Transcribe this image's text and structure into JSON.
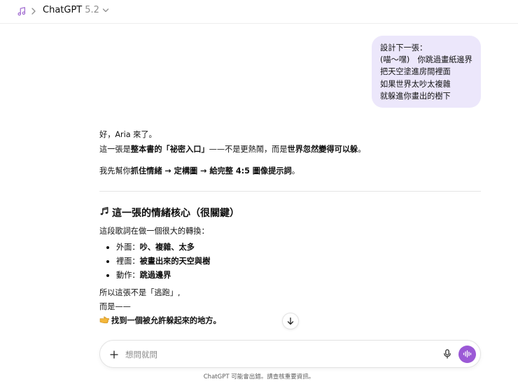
{
  "header": {
    "music_icon": "music-note-icon",
    "breadcrumb_separator": "chevron-right-icon",
    "app_name": "ChatGPT",
    "model_version": "5.2",
    "model_dropdown_icon": "chevron-down-icon"
  },
  "user_message": {
    "lines": [
      "設計下一張：",
      "(喵～嘿)　你跳過畫紙邊界",
      "把天空塗進房間裡面",
      "如果世界太吵太複雜",
      "就躲進你畫出的樹下"
    ]
  },
  "assistant_message": {
    "greeting": "好，Aria 來了。",
    "line2": {
      "a": "這一張是",
      "b": "整本書的「祕密入口」",
      "c": "——不是更熱鬧，而是",
      "d": "世界忽然變得可以躲",
      "e": "。"
    },
    "line3": {
      "a": "我先幫你",
      "b": "抓住情緒 → 定構圖 → 給完整 4:5 圖像提示詞",
      "c": "。"
    },
    "section_icon": "music-notes-icon",
    "section_title": "這一張的情緒核心（很關鍵）",
    "intro": "這段歌詞在做一個很大的轉換：",
    "bullets": [
      {
        "label": "外面：",
        "value": "吵、複雜、太多"
      },
      {
        "label": "裡面：",
        "value": "被畫出來的天空與樹"
      },
      {
        "label": "動作：",
        "value": "跳過邊界"
      }
    ],
    "para2": "所以這張不是「逃跑」,",
    "para3": "而是——",
    "pointer_icon": "backhand-index-pointing-right-icon",
    "para4": "找到一個被允許躲起來的地方。"
  },
  "scroll_button_icon": "arrow-down-icon",
  "composer": {
    "plus_icon": "plus-icon",
    "placeholder": "想問就問",
    "mic_icon": "microphone-icon",
    "voice_icon": "voice-waveform-icon",
    "voice_color": "#9b59d6"
  },
  "footer": {
    "disclaimer": "ChatGPT 可能會出錯。請查核重要資訊。"
  },
  "theme": {
    "user_bubble_bg": "#ece7fb",
    "accent_purple": "#9b59d6"
  }
}
